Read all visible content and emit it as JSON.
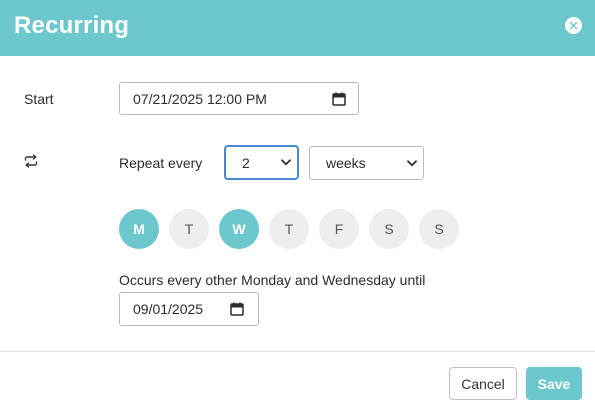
{
  "dialog": {
    "title": "Recurring",
    "accent_color": "#6cc8cc",
    "close_icon": "close-icon"
  },
  "start": {
    "label": "Start",
    "value": "07/21/2025 12:00 PM",
    "icon": "calendar-icon"
  },
  "repeat": {
    "icon": "repeat-icon",
    "label": "Repeat every",
    "interval": "2",
    "unit": "weeks"
  },
  "weekdays": [
    {
      "label": "M",
      "selected": true
    },
    {
      "label": "T",
      "selected": false
    },
    {
      "label": "W",
      "selected": true
    },
    {
      "label": "T",
      "selected": false
    },
    {
      "label": "F",
      "selected": false
    },
    {
      "label": "S",
      "selected": false
    },
    {
      "label": "S",
      "selected": false
    }
  ],
  "summary": {
    "text": "Occurs every other Monday and Wednesday until",
    "until_value": "09/01/2025",
    "until_icon": "calendar-icon"
  },
  "footer": {
    "cancel_label": "Cancel",
    "save_label": "Save"
  }
}
